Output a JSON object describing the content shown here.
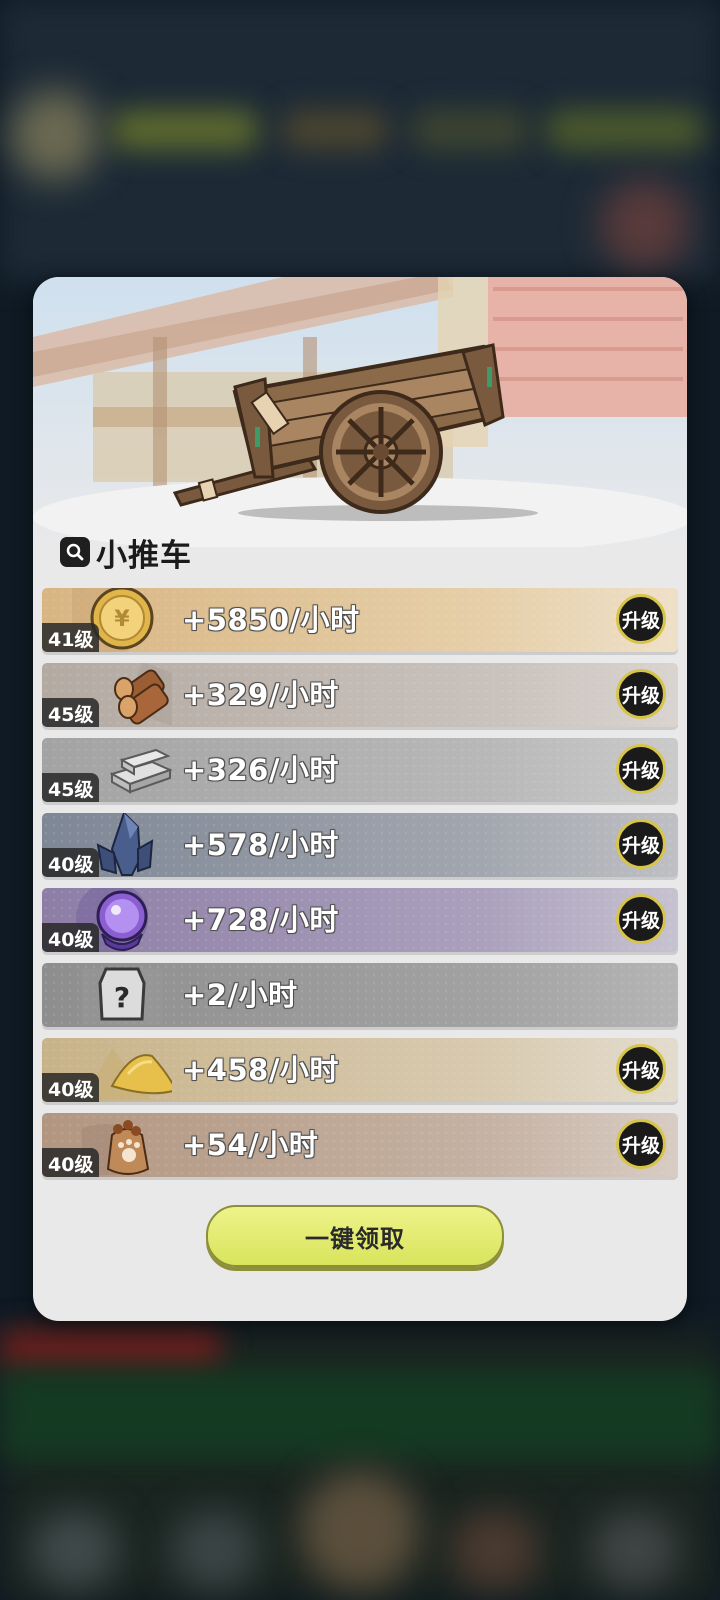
{
  "building": {
    "name": "小推车"
  },
  "rows": [
    {
      "level": "41级",
      "rate": "+5850/小时",
      "resource": "gold-coin",
      "upgrade": "升级",
      "color": "#d6b07f"
    },
    {
      "level": "45级",
      "rate": "+329/小时",
      "resource": "wood-logs",
      "upgrade": "升级",
      "color": "#a89f97"
    },
    {
      "level": "45级",
      "rate": "+326/小时",
      "resource": "stone-bricks",
      "upgrade": "升级",
      "color": "#9c9c9c"
    },
    {
      "level": "40级",
      "rate": "+578/小时",
      "resource": "crystal",
      "upgrade": "升级",
      "color": "#7d8594"
    },
    {
      "level": "40级",
      "rate": "+728/小时",
      "resource": "magic-orb",
      "upgrade": "升级",
      "color": "#9889ad"
    },
    {
      "level": "",
      "rate": "+2/小时",
      "resource": "unknown-armor",
      "upgrade": "",
      "color": "#8c8c8c"
    },
    {
      "level": "40级",
      "rate": "+458/小时",
      "resource": "sand-pile",
      "upgrade": "升级",
      "color": "#c7b289"
    },
    {
      "level": "40级",
      "rate": "+54/小时",
      "resource": "paw-sack",
      "upgrade": "升级",
      "color": "#b49a86"
    }
  ],
  "claim_button": "一键领取"
}
